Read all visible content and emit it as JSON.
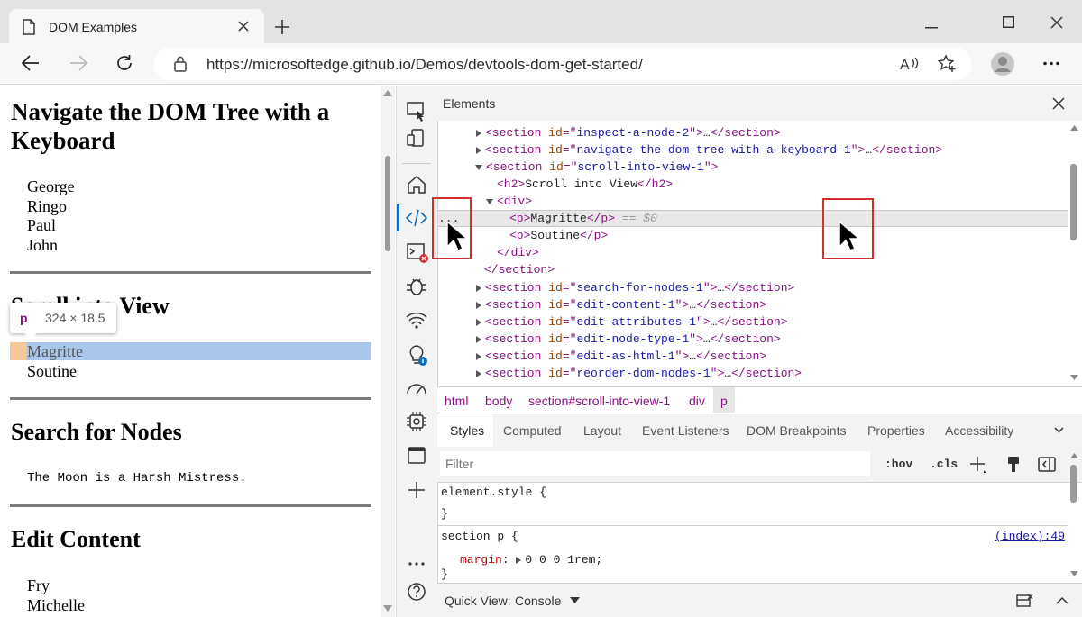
{
  "browser": {
    "tab_title": "DOM Examples",
    "new_tab_label": "+",
    "address": "https://microsoftedge.github.io/Demos/devtools-dom-get-started/",
    "menu_label": "..."
  },
  "page": {
    "heading1": "Navigate the DOM Tree with a",
    "heading1b": "Keyboard",
    "beatles": [
      "George",
      "Ringo",
      "Paul",
      "John"
    ],
    "heading2": "Scroll into View",
    "tooltip_tag": "p",
    "tooltip_size": "324 × 18.5",
    "painters": [
      "Magritte",
      "Soutine"
    ],
    "heading3": "Search for Nodes",
    "moon": "The Moon is a Harsh Mistress.",
    "heading4": "Edit Content",
    "names": [
      "Fry",
      "Michelle"
    ]
  },
  "devtools": {
    "panel_title": "Elements",
    "dom": {
      "sec_inspect": "inspect-a-node-2",
      "sec_navigate": "navigate-the-dom-tree-with-a-keyboard-1",
      "sec_scroll": "scroll-into-view-1",
      "h2_text": "Scroll into View",
      "p1_text": "Magritte",
      "p1_suffix": "== $0",
      "p2_text": "Soutine",
      "sec_search": "search-for-nodes-1",
      "sec_edit_content": "edit-content-1",
      "sec_edit_attr": "edit-attributes-1",
      "sec_edit_type": "edit-node-type-1",
      "sec_edit_html": "edit-as-html-1",
      "sec_reorder": "reorder-dom-nodes-1",
      "ellipsis": "..."
    },
    "breadcrumbs": [
      "html",
      "body",
      "section#scroll-into-view-1",
      "div",
      "p"
    ],
    "style_tabs": [
      "Styles",
      "Computed",
      "Layout",
      "Event Listeners",
      "DOM Breakpoints",
      "Properties",
      "Accessibility"
    ],
    "filter_placeholder": "Filter",
    "hov": ":hov",
    "cls": ".cls",
    "styles": {
      "element_style": "element.style {",
      "close_brace": "}",
      "rule_selector": "section p {",
      "rule_source": "(index):49",
      "prop_name": "margin",
      "prop_value": "0 0 0 1rem;"
    },
    "quick_view_label": "Quick View:",
    "quick_view_value": "Console"
  },
  "colors": {
    "highlight_blue": "#a8c7ea",
    "highlight_orange": "#f6c79b",
    "annotation_red": "#d32f2f",
    "selected_row": "#e8e8e8"
  }
}
